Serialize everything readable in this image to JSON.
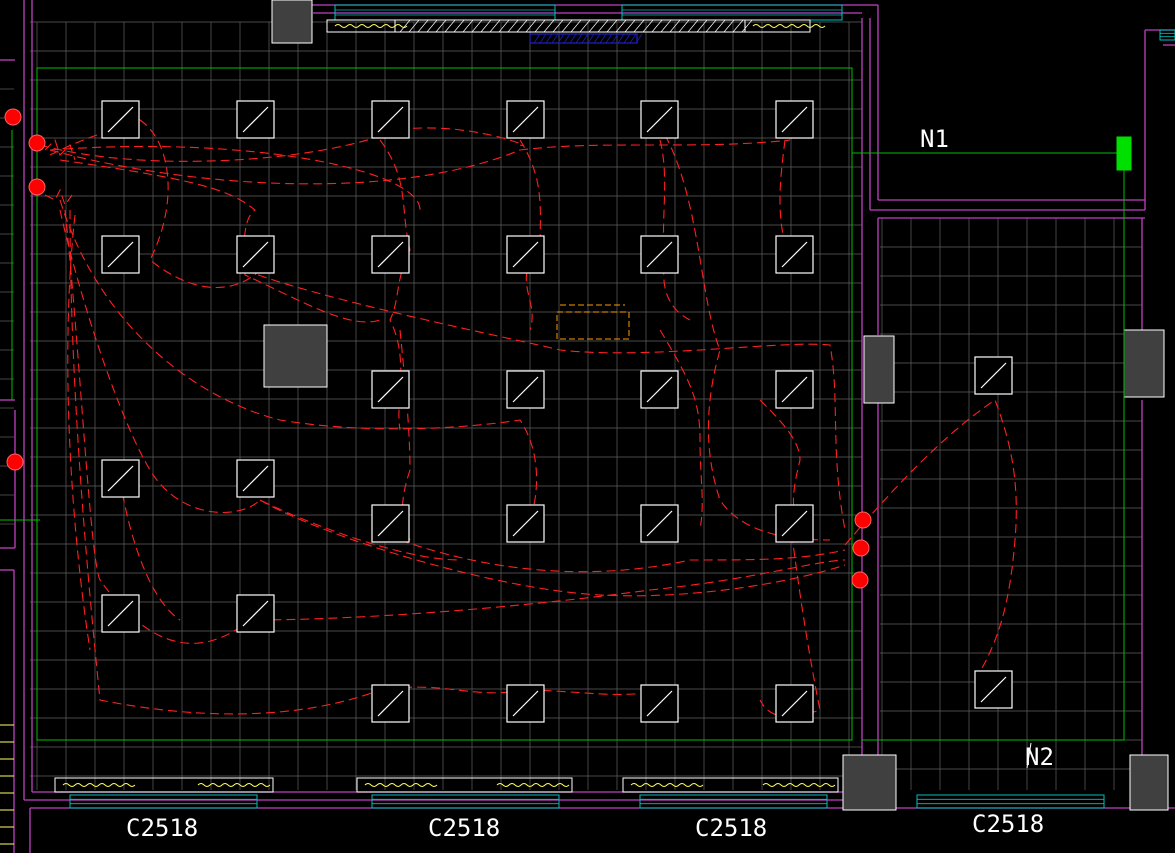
{
  "drawing": {
    "background": "#000000",
    "colors": {
      "wall": "#c040c0",
      "grid": "#606060",
      "circuit": "#ff2020",
      "fixture": "#ffffff",
      "panel_line": "#00c000",
      "panel": "#00e000",
      "window": "#00c0c0",
      "column": "#404040",
      "outlet": "#ff0000",
      "label": "#ffffff",
      "radiator": "#ffff60",
      "hatch": "#ffffff",
      "beam": "#2020c0",
      "equipment": "#ff9900"
    },
    "panel_labels": [
      "N1",
      "N2"
    ],
    "window_labels": [
      "C2518",
      "C2518",
      "C2518",
      "C2518"
    ],
    "icons": {
      "fixture": "ceiling-light-fixture-icon",
      "outlet": "outlet-dot-icon",
      "panel": "distribution-box-icon"
    }
  }
}
